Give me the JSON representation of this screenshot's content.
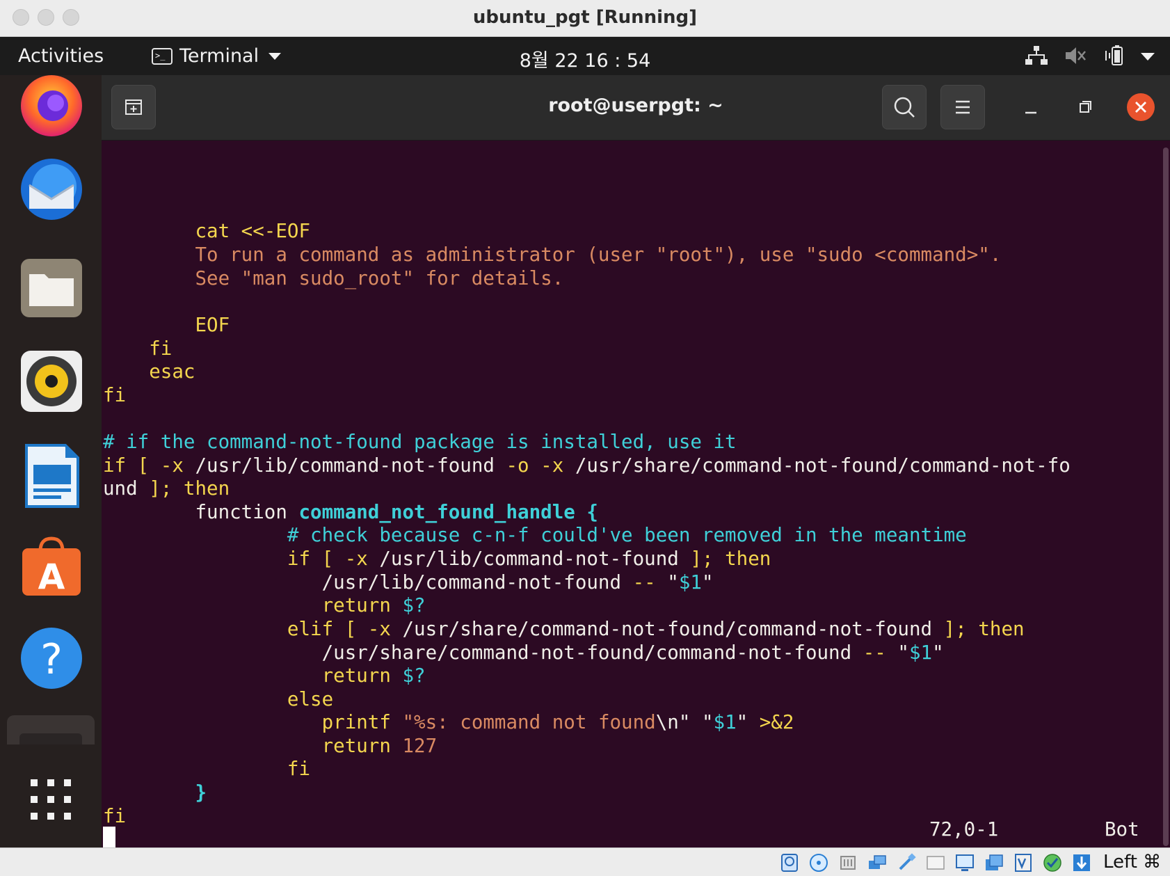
{
  "window": {
    "title": "ubuntu_pgt [Running]"
  },
  "topbar": {
    "activities": "Activities",
    "app_menu": "Terminal",
    "clock": "8월 22  16 : 54"
  },
  "dock": {
    "items": [
      "firefox-icon",
      "thunderbird-icon",
      "files-icon",
      "rhythmbox-icon",
      "libreoffice-impress-icon",
      "app-center-icon",
      "help-icon",
      "terminal-icon",
      "show-apps-icon"
    ]
  },
  "terminal": {
    "title": "root@userpgt: ~",
    "lines": {
      "l1": "cat <<-EOF",
      "l2": "To run a command as administrator (user \"root\"), use \"sudo <command>\".",
      "l3": "See \"man sudo_root\" for details.",
      "l4": "EOF",
      "l5": "fi",
      "l6": "esac",
      "l7": "fi",
      "l8": "# if the command-not-found package is installed, use it",
      "l9a": "if",
      "l9b": " [ -x ",
      "l9c": "/usr/lib/command-not-found",
      "l9d": " -o -x ",
      "l9e": "/usr/share/command-not-found/command-not-fo",
      "l10a": "und",
      "l10b": " ]; ",
      "l10c": "then",
      "l11a": "function ",
      "l11b": "command_not_found_handle",
      "l11c": " {",
      "l12": "# check because c-n-f could've been removed in the meantime",
      "l13a": "if",
      "l13b": " [ -x ",
      "l13c": "/usr/lib/command-not-found",
      "l13d": " ]; ",
      "l13e": "then",
      "l14a": "/usr/lib/command-not-found",
      "l14b": " -- ",
      "l14c": "\"",
      "l14d": "$1",
      "l14e": "\"",
      "l15a": "return ",
      "l15b": "$?",
      "l16a": "elif",
      "l16b": " [ -x ",
      "l16c": "/usr/share/command-not-found/command-not-found",
      "l16d": " ]; ",
      "l16e": "then",
      "l17a": "/usr/share/command-not-found/command-not-found",
      "l17b": " -- ",
      "l17c": "\"",
      "l17d": "$1",
      "l17e": "\"",
      "l18a": "return ",
      "l18b": "$?",
      "l19": "else",
      "l20a": "printf ",
      "l20b": "\"%s: command not found",
      "l20c": "\\n",
      "l20d": "\"",
      "l20e": " \"",
      "l20f": "$1",
      "l20g": "\"",
      "l20h": " >&2",
      "l21a": "return ",
      "l21b": "127",
      "l22": "fi",
      "l23": "}",
      "l24": "fi"
    },
    "status": {
      "position": "72,0-1",
      "scroll": "Bot"
    }
  },
  "vbox_status": {
    "host_key": "Left ⌘"
  }
}
